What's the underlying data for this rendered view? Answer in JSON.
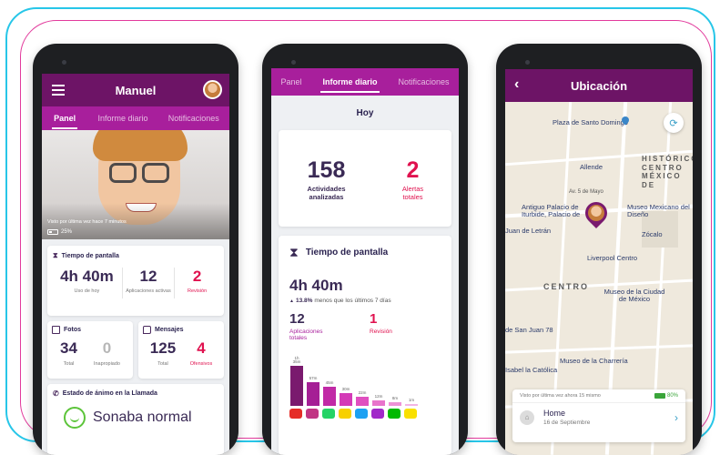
{
  "phone1": {
    "title": "Manuel",
    "tabs": [
      "Panel",
      "Informe diario",
      "Notificaciones"
    ],
    "last_seen": "Visto por última vez hace 7 minutos",
    "battery": "25%",
    "screen_time": {
      "title": "Tiempo de pantalla",
      "usage": "4h 40m",
      "usage_label": "Uso de hoy",
      "apps": "12",
      "apps_label": "Aplicaciones activas",
      "review": "2",
      "review_label": "Revisión"
    },
    "photos": {
      "title": "Fotos",
      "total": "34",
      "total_label": "Total",
      "inappropriate": "0",
      "inappropriate_label": "Inapropiado"
    },
    "messages": {
      "title": "Mensajes",
      "total": "125",
      "total_label": "Total",
      "offensive": "4",
      "offensive_label": "Ofensivos"
    },
    "mood": {
      "title": "Estado de ánimo en la Llamada",
      "value": "Sonaba normal"
    }
  },
  "phone2": {
    "tabs": [
      "Panel",
      "Informe diario",
      "Notificaciones"
    ],
    "today": "Hoy",
    "activities": "158",
    "activities_label": "Actividades analizadas",
    "alerts": "2",
    "alerts_label": "Alertas totales",
    "screen_time_title": "Tiempo de pantalla",
    "usage": "4h 40m",
    "trend": "13.8%",
    "trend_text": "menos que los últimos 7 días",
    "apps": "12",
    "apps_label": "Aplicaciones totales",
    "review": "1",
    "review_label": "Revisión",
    "bars": [
      {
        "label": "1h 35m",
        "value": 95,
        "color": "#7a1a6e"
      },
      {
        "label": "57m",
        "value": 57,
        "color": "#a51f95"
      },
      {
        "label": "45m",
        "value": 45,
        "color": "#c12aa6"
      },
      {
        "label": "30m",
        "value": 30,
        "color": "#d43ab7"
      },
      {
        "label": "22m",
        "value": 22,
        "color": "#e04fc0"
      },
      {
        "label": "12m",
        "value": 12,
        "color": "#e874cc"
      },
      {
        "label": "8m",
        "value": 8,
        "color": "#ee92d7"
      },
      {
        "label": "1m",
        "value": 1,
        "color": "#f3b5e4"
      }
    ],
    "app_icons": [
      "youtube-icon",
      "instagram-icon",
      "whatsapp-icon",
      "snapchat-icon",
      "twitter-icon",
      "messenger-icon",
      "line-icon",
      "kakao-icon"
    ],
    "app_colors": [
      "#e52d27",
      "#c13584",
      "#25d366",
      "#f7d000",
      "#1da1f2",
      "#a128c9",
      "#00b900",
      "#f9e000"
    ]
  },
  "phone3": {
    "title": "Ubicación",
    "map_labels": [
      "Plaza de Santo Domingo",
      "Allende",
      "Av. 5 de Mayo",
      "Antiguo Palacio de Iturbide, Palacio de",
      "Museo Mexicano del Diseño",
      "Zócalo",
      "Liverpool Centro",
      "CENTRO",
      "Museo de la Ciudad de México",
      "de San Juan 78",
      "Museo de la Charrería",
      "Juan de Letrán",
      "Isabel la Católica",
      "HISTÓRICO CENTRO MÉXICO DE"
    ],
    "last_seen": "Visto por última vez ahora 15 mismo",
    "battery": "80%",
    "place": "Home",
    "date": "16 de Septiembre"
  }
}
